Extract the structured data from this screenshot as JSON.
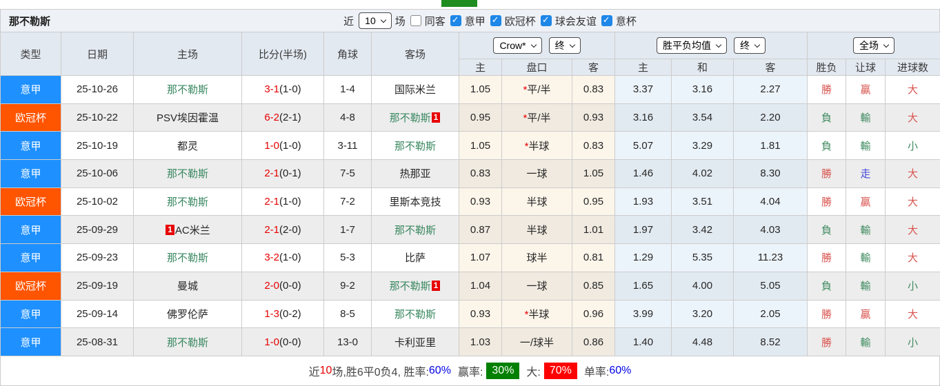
{
  "colors": {
    "league_serie_a": "#1e90ff",
    "league_ucl": "#ff5400",
    "team_highlight_green": "#38875f",
    "score_red": "#e60000",
    "result_red": "#d9534e",
    "result_green": "#3e8b5f",
    "result_blue": "#4646d9",
    "rate_blue": "#0000e6",
    "win_rate_green_bg": "#008000",
    "big_rate_red_bg": "#ff0000",
    "active_tab_green": "#1f8c1f"
  },
  "title_bar": {
    "team_name": "那不勒斯",
    "recent_label": "近",
    "recent_count": "10",
    "matches_label": "场",
    "filters": [
      {
        "label": "同客",
        "checked": false
      },
      {
        "label": "意甲",
        "checked": true
      },
      {
        "label": "欧冠杯",
        "checked": true
      },
      {
        "label": "球会友谊",
        "checked": true
      },
      {
        "label": "意杯",
        "checked": true
      }
    ]
  },
  "header": {
    "main_cols": [
      "类型",
      "日期",
      "主场",
      "比分(半场)",
      "角球",
      "客场"
    ],
    "selects": {
      "bookmaker": "Crow*",
      "time_a": "终",
      "avg": "胜平负均值",
      "time_b": "终",
      "scope": "全场"
    },
    "sub_cols": [
      "主",
      "盘口",
      "客",
      "主",
      "和",
      "客",
      "胜负",
      "让球",
      "进球数"
    ]
  },
  "rows": [
    {
      "type": "意甲",
      "type_class": "type-blue",
      "date": "25-10-26",
      "home": "那不勒斯",
      "home_class": "team-green",
      "home_card_pre": "",
      "home_card_post": "",
      "score": "3-1",
      "half": "(1-0)",
      "corner": "1-4",
      "away": "国际米兰",
      "away_class": "",
      "away_card_post": "",
      "odds_home": "1.05",
      "handicap_star": "*",
      "handicap": "平/半",
      "odds_away": "0.83",
      "avg_home": "3.37",
      "avg_draw": "3.16",
      "avg_away": "2.27",
      "wl": "勝",
      "wl_class": "c-red",
      "hc": "贏",
      "hc_class": "c-red",
      "goals": "大",
      "goals_class": "c-red"
    },
    {
      "type": "欧冠杯",
      "type_class": "type-orange",
      "date": "25-10-22",
      "home": "PSV埃因霍温",
      "home_class": "",
      "home_card_pre": "",
      "home_card_post": "",
      "score": "6-2",
      "half": "(2-1)",
      "corner": "4-8",
      "away": "那不勒斯",
      "away_class": "team-green",
      "away_card_post": "1",
      "odds_home": "0.95",
      "handicap_star": "*",
      "handicap": "平/半",
      "odds_away": "0.93",
      "avg_home": "3.16",
      "avg_draw": "3.54",
      "avg_away": "2.20",
      "wl": "負",
      "wl_class": "c-green",
      "hc": "輸",
      "hc_class": "c-green",
      "goals": "大",
      "goals_class": "c-red"
    },
    {
      "type": "意甲",
      "type_class": "type-blue",
      "date": "25-10-19",
      "home": "都灵",
      "home_class": "",
      "home_card_pre": "",
      "home_card_post": "",
      "score": "1-0",
      "half": "(1-0)",
      "corner": "3-11",
      "away": "那不勒斯",
      "away_class": "team-green",
      "away_card_post": "",
      "odds_home": "1.05",
      "handicap_star": "*",
      "handicap": "半球",
      "odds_away": "0.83",
      "avg_home": "5.07",
      "avg_draw": "3.29",
      "avg_away": "1.81",
      "wl": "負",
      "wl_class": "c-green",
      "hc": "輸",
      "hc_class": "c-green",
      "goals": "小",
      "goals_class": "c-green"
    },
    {
      "type": "意甲",
      "type_class": "type-blue",
      "date": "25-10-06",
      "home": "那不勒斯",
      "home_class": "team-green",
      "home_card_pre": "",
      "home_card_post": "",
      "score": "2-1",
      "half": "(0-1)",
      "corner": "7-5",
      "away": "热那亚",
      "away_class": "",
      "away_card_post": "",
      "odds_home": "0.83",
      "handicap_star": "",
      "handicap": "一球",
      "odds_away": "1.05",
      "avg_home": "1.46",
      "avg_draw": "4.02",
      "avg_away": "8.30",
      "wl": "勝",
      "wl_class": "c-red",
      "hc": "走",
      "hc_class": "c-blue",
      "goals": "大",
      "goals_class": "c-red"
    },
    {
      "type": "欧冠杯",
      "type_class": "type-orange",
      "date": "25-10-02",
      "home": "那不勒斯",
      "home_class": "team-green",
      "home_card_pre": "",
      "home_card_post": "",
      "score": "2-1",
      "half": "(1-0)",
      "corner": "7-2",
      "away": "里斯本竞技",
      "away_class": "",
      "away_card_post": "",
      "odds_home": "0.93",
      "handicap_star": "",
      "handicap": "半球",
      "odds_away": "0.95",
      "avg_home": "1.93",
      "avg_draw": "3.51",
      "avg_away": "4.04",
      "wl": "勝",
      "wl_class": "c-red",
      "hc": "贏",
      "hc_class": "c-red",
      "goals": "大",
      "goals_class": "c-red"
    },
    {
      "type": "意甲",
      "type_class": "type-blue",
      "date": "25-09-29",
      "home": "AC米兰",
      "home_class": "",
      "home_card_pre": "1",
      "home_card_post": "",
      "score": "2-1",
      "half": "(2-0)",
      "corner": "1-7",
      "away": "那不勒斯",
      "away_class": "team-green",
      "away_card_post": "",
      "odds_home": "0.87",
      "handicap_star": "",
      "handicap": "半球",
      "odds_away": "1.01",
      "avg_home": "1.97",
      "avg_draw": "3.42",
      "avg_away": "4.03",
      "wl": "負",
      "wl_class": "c-green",
      "hc": "輸",
      "hc_class": "c-green",
      "goals": "大",
      "goals_class": "c-red"
    },
    {
      "type": "意甲",
      "type_class": "type-blue",
      "date": "25-09-23",
      "home": "那不勒斯",
      "home_class": "team-green",
      "home_card_pre": "",
      "home_card_post": "",
      "score": "3-2",
      "half": "(1-0)",
      "corner": "5-3",
      "away": "比萨",
      "away_class": "",
      "away_card_post": "",
      "odds_home": "1.07",
      "handicap_star": "",
      "handicap": "球半",
      "odds_away": "0.81",
      "avg_home": "1.29",
      "avg_draw": "5.35",
      "avg_away": "11.23",
      "wl": "勝",
      "wl_class": "c-red",
      "hc": "輸",
      "hc_class": "c-green",
      "goals": "大",
      "goals_class": "c-red"
    },
    {
      "type": "欧冠杯",
      "type_class": "type-orange",
      "date": "25-09-19",
      "home": "曼城",
      "home_class": "",
      "home_card_pre": "",
      "home_card_post": "",
      "score": "2-0",
      "half": "(0-0)",
      "corner": "9-2",
      "away": "那不勒斯",
      "away_class": "team-green",
      "away_card_post": "1",
      "odds_home": "1.04",
      "handicap_star": "",
      "handicap": "一球",
      "odds_away": "0.85",
      "avg_home": "1.65",
      "avg_draw": "4.00",
      "avg_away": "5.05",
      "wl": "負",
      "wl_class": "c-green",
      "hc": "輸",
      "hc_class": "c-green",
      "goals": "小",
      "goals_class": "c-green"
    },
    {
      "type": "意甲",
      "type_class": "type-blue",
      "date": "25-09-14",
      "home": "佛罗伦萨",
      "home_class": "",
      "home_card_pre": "",
      "home_card_post": "",
      "score": "1-3",
      "half": "(0-2)",
      "corner": "8-5",
      "away": "那不勒斯",
      "away_class": "team-green",
      "away_card_post": "",
      "odds_home": "0.93",
      "handicap_star": "*",
      "handicap": "半球",
      "odds_away": "0.96",
      "avg_home": "3.99",
      "avg_draw": "3.20",
      "avg_away": "2.05",
      "wl": "勝",
      "wl_class": "c-red",
      "hc": "贏",
      "hc_class": "c-red",
      "goals": "大",
      "goals_class": "c-red"
    },
    {
      "type": "意甲",
      "type_class": "type-blue",
      "date": "25-08-31",
      "home": "那不勒斯",
      "home_class": "team-green",
      "home_card_pre": "",
      "home_card_post": "",
      "score": "1-0",
      "half": "(0-0)",
      "corner": "13-0",
      "away": "卡利亚里",
      "away_class": "",
      "away_card_post": "",
      "odds_home": "1.03",
      "handicap_star": "",
      "handicap": "一/球半",
      "odds_away": "0.86",
      "avg_home": "1.40",
      "avg_draw": "4.48",
      "avg_away": "8.52",
      "wl": "勝",
      "wl_class": "c-red",
      "hc": "輸",
      "hc_class": "c-green",
      "goals": "小",
      "goals_class": "c-green"
    }
  ],
  "footer": {
    "segments": [
      {
        "text": "近",
        "cls": ""
      },
      {
        "text": "10",
        "cls": "f-red"
      },
      {
        "text": "场,胜6平0负4, 胜率:",
        "cls": ""
      },
      {
        "text": "60%",
        "cls": "f-blue"
      },
      {
        "text": "赢率:",
        "cls": "f-label"
      },
      {
        "text": "30%",
        "cls": "f-greenbg"
      },
      {
        "text": "大:",
        "cls": "f-label"
      },
      {
        "text": "70%",
        "cls": "f-redbg"
      },
      {
        "text": "单率:",
        "cls": "f-label"
      },
      {
        "text": "60%",
        "cls": "f-blue"
      }
    ]
  }
}
